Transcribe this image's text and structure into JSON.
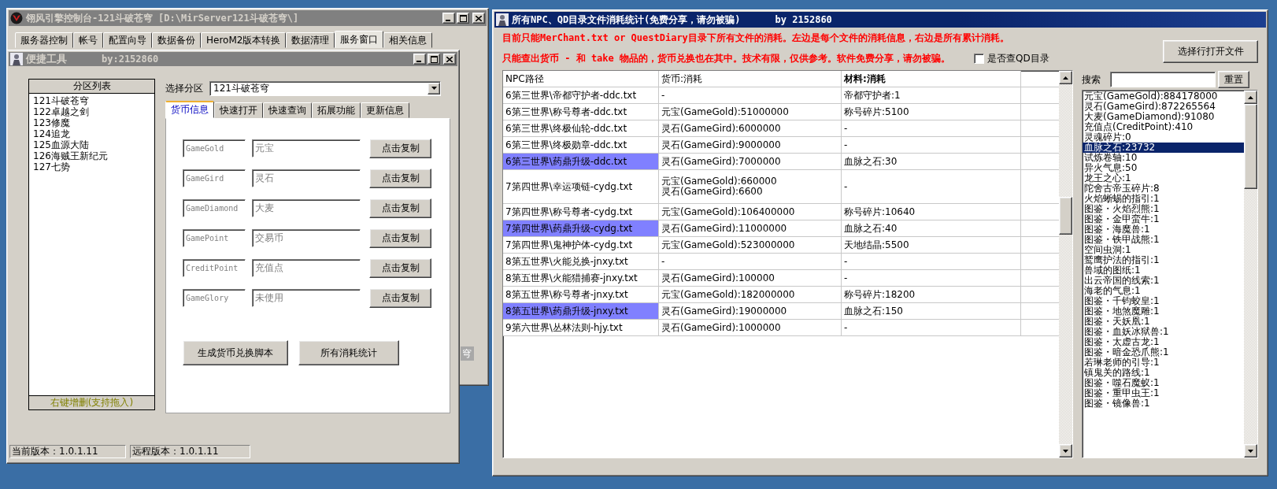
{
  "main_window": {
    "title": "翎风引擎控制台-121斗破苍穹 [D:\\MirServer121斗破苍穹\\]",
    "tabs": [
      {
        "label": "服务器控制",
        "selected": false
      },
      {
        "label": "帐号",
        "selected": false
      },
      {
        "label": "配置向导",
        "selected": false
      },
      {
        "label": "数据备份",
        "selected": false
      },
      {
        "label": "HeroM2版本转换",
        "selected": false
      },
      {
        "label": "数据清理",
        "selected": false
      },
      {
        "label": "服务窗口",
        "selected": true
      },
      {
        "label": "相关信息",
        "selected": false
      }
    ],
    "partial_button": "穹"
  },
  "tool_window": {
    "title": "便捷工具",
    "author": "by:2152860",
    "partition_list": {
      "header": "分区列表",
      "items": [
        "121斗破苍穹",
        "122卓越之剑",
        "123修魔",
        "124追龙",
        "125血源大陆",
        "126海贼王新纪元",
        "127七势"
      ],
      "footer": "右键增删(支持拖入)"
    },
    "select": {
      "label": "选择分区",
      "value": "121斗破苍穹"
    },
    "tabs": [
      {
        "label": "货币信息",
        "selected": true
      },
      {
        "label": "快速打开",
        "selected": false
      },
      {
        "label": "快速查询",
        "selected": false
      },
      {
        "label": "拓展功能",
        "selected": false
      },
      {
        "label": "更新信息",
        "selected": false
      }
    ],
    "currency_rows": [
      {
        "key": "GameGold",
        "name": "元宝",
        "button": "点击复制"
      },
      {
        "key": "GameGird",
        "name": "灵石",
        "button": "点击复制"
      },
      {
        "key": "GameDiamond",
        "name": "大麦",
        "button": "点击复制"
      },
      {
        "key": "GamePoint",
        "name": "交易币",
        "button": "点击复制"
      },
      {
        "key": "CreditPoint",
        "name": "充值点",
        "button": "点击复制"
      },
      {
        "key": "GameGlory",
        "name": "未使用",
        "button": "点击复制"
      }
    ],
    "actions": [
      "生成货币兑换脚本",
      "所有消耗统计"
    ],
    "status_bar": [
      "当前版本：1.0.1.11",
      "远程版本：1.0.1.11"
    ]
  },
  "stats_window": {
    "title": "所有NPC、QD目录文件消耗统计(免费分享，请勿被骗)",
    "author": "by 2152860",
    "notices": [
      "目前只能MerChant.txt or QuestDiary目录下所有文件的消耗。左边是每个文件的消耗信息，右边是所有累计消耗。",
      "只能查出货币 - 和 take 物品的，货币兑换也在其中。技术有限，仅供参考。软件免费分享，请勿被骗。"
    ],
    "checkbox": {
      "label": "是否查QD目录",
      "checked": false
    },
    "open_button": "选择行打开文件",
    "table": {
      "columns": [
        {
          "label": "NPC路径",
          "sorted": false
        },
        {
          "label": "货币:消耗",
          "sorted": false
        },
        {
          "label": "材料:消耗",
          "sorted": true
        }
      ],
      "rows": [
        {
          "path": "6第三世界\\帝都守护者-ddc.txt",
          "currency": [
            "-"
          ],
          "material": "帝都守护者:1",
          "selected": false
        },
        {
          "path": "6第三世界\\称号尊者-ddc.txt",
          "currency": [
            "元宝(GameGold):51000000"
          ],
          "material": "称号碎片:5100",
          "selected": false
        },
        {
          "path": "6第三世界\\终极仙轮-ddc.txt",
          "currency": [
            "灵石(GameGird):6000000"
          ],
          "material": "-",
          "selected": false
        },
        {
          "path": "6第三世界\\终极勋章-ddc.txt",
          "currency": [
            "灵石(GameGird):9000000"
          ],
          "material": "-",
          "selected": false
        },
        {
          "path": "6第三世界\\药鼎升级-ddc.txt",
          "currency": [
            "灵石(GameGird):7000000"
          ],
          "material": "血脉之石:30",
          "selected": true
        },
        {
          "path": "7第四世界\\幸运项链-cydg.txt",
          "currency": [
            "元宝(GameGold):660000",
            "灵石(GameGird):6600"
          ],
          "material": "-",
          "selected": false
        },
        {
          "path": "7第四世界\\称号尊者-cydg.txt",
          "currency": [
            "元宝(GameGold):106400000"
          ],
          "material": "称号碎片:10640",
          "selected": false
        },
        {
          "path": "7第四世界\\药鼎升级-cydg.txt",
          "currency": [
            "灵石(GameGird):11000000"
          ],
          "material": "血脉之石:40",
          "selected": true
        },
        {
          "path": "7第四世界\\鬼神护体-cydg.txt",
          "currency": [
            "元宝(GameGold):523000000"
          ],
          "material": "天地结晶:5500",
          "selected": false
        },
        {
          "path": "8第五世界\\火能兑换-jnxy.txt",
          "currency": [
            "-"
          ],
          "material": "-",
          "selected": false
        },
        {
          "path": "8第五世界\\火能猎捕赛-jnxy.txt",
          "currency": [
            "灵石(GameGird):100000"
          ],
          "material": "-",
          "selected": false
        },
        {
          "path": "8第五世界\\称号尊者-jnxy.txt",
          "currency": [
            "元宝(GameGold):182000000"
          ],
          "material": "称号碎片:18200",
          "selected": false
        },
        {
          "path": "8第五世界\\药鼎升级-jnxy.txt",
          "currency": [
            "灵石(GameGird):19000000"
          ],
          "material": "血脉之石:150",
          "selected": true
        },
        {
          "path": "9第六世界\\丛林法则-hjy.txt",
          "currency": [
            "灵石(GameGird):1000000"
          ],
          "material": "-",
          "selected": false
        }
      ]
    },
    "search": {
      "label": "搜索",
      "reset": "重置"
    },
    "totals": [
      {
        "label": "元宝(GameGold):884178000",
        "selected": false
      },
      {
        "label": "灵石(GameGird):872265564",
        "selected": false
      },
      {
        "label": "大麦(GameDiamond):91080",
        "selected": false
      },
      {
        "label": "充值点(CreditPoint):410",
        "selected": false
      },
      {
        "label": "灵魂碎片:0",
        "selected": false
      },
      {
        "label": "血脉之石:23732",
        "selected": true
      },
      {
        "label": "试炼卷轴:10",
        "selected": false
      },
      {
        "label": "异火气息:50",
        "selected": false
      },
      {
        "label": "龙王之心:1",
        "selected": false
      },
      {
        "label": "陀舍古帝玉碎片:8",
        "selected": false
      },
      {
        "label": "火焰蜥蜴的指引:1",
        "selected": false
      },
      {
        "label": "图鉴・火焰烈熊:1",
        "selected": false
      },
      {
        "label": "图鉴・金甲蛮牛:1",
        "selected": false
      },
      {
        "label": "图鉴・海魔兽:1",
        "selected": false
      },
      {
        "label": "图鉴・铁甲战熊:1",
        "selected": false
      },
      {
        "label": "空间虫洞:1",
        "selected": false
      },
      {
        "label": "鹫鹰护法的指引:1",
        "selected": false
      },
      {
        "label": "兽域的图纸:1",
        "selected": false
      },
      {
        "label": "出云帝国的线索:1",
        "selected": false
      },
      {
        "label": "海老的气息:1",
        "selected": false
      },
      {
        "label": "图鉴・千钧蛟皇:1",
        "selected": false
      },
      {
        "label": "图鉴・地煞魔雕:1",
        "selected": false
      },
      {
        "label": "图鉴・天妖凰:1",
        "selected": false
      },
      {
        "label": "图鉴・血妖冰狱兽:1",
        "selected": false
      },
      {
        "label": "图鉴・太虚古龙:1",
        "selected": false
      },
      {
        "label": "图鉴・暗金恐爪熊:1",
        "selected": false
      },
      {
        "label": "若琳老师的引导:1",
        "selected": false
      },
      {
        "label": "镇鬼关的路线:1",
        "selected": false
      },
      {
        "label": "图鉴・噬石魔蚁:1",
        "selected": false
      },
      {
        "label": "图鉴・重甲虫王:1",
        "selected": false
      },
      {
        "label": "图鉴・镜像兽:1",
        "selected": false
      }
    ]
  }
}
